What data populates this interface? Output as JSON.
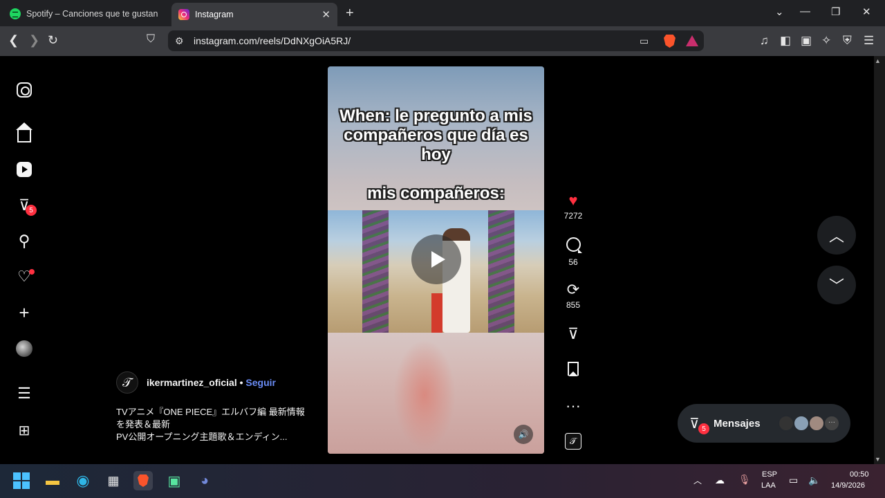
{
  "browser": {
    "tabs": [
      {
        "label": "Spotify – Canciones que te gustan",
        "active": false
      },
      {
        "label": "Instagram",
        "active": true
      }
    ],
    "url": "instagram.com/reels/DdNXgOiA5RJ/"
  },
  "sidebar": {
    "messages_badge": "5"
  },
  "reel": {
    "overlay_line1": "When: le pregunto a mis compañeros que día es hoy",
    "overlay_line2": "mis compañeros:",
    "author": "ikermartinez_oficial",
    "separator": "•",
    "follow_label": "Seguir",
    "description_line1": "TVアニメ『ONE PIECE』エルバフ編 最新情報を発表＆最新",
    "description_line2": "PV公開オープニング主題歌＆エンディン...",
    "likes": "7272",
    "comments": "56",
    "reposts": "855"
  },
  "messages": {
    "label": "Mensajes",
    "badge": "5"
  },
  "taskbar": {
    "lang1": "ESP",
    "lang2": "LAA",
    "time": "00:50",
    "date": "14/9/2026"
  }
}
